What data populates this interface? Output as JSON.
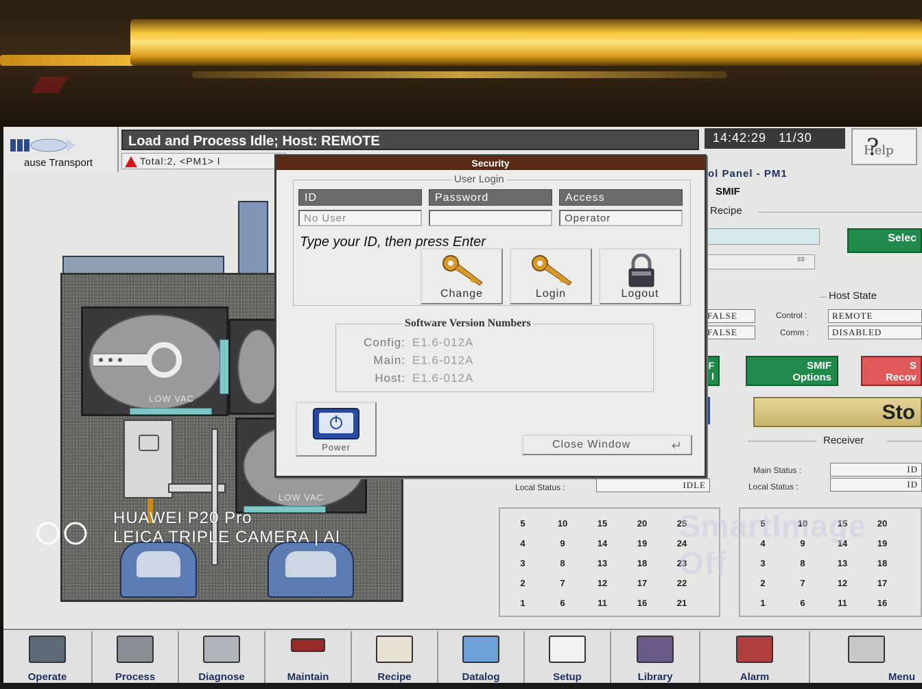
{
  "header": {
    "status": "Load and Process Idle; Host: REMOTE",
    "alarm": "Total:2, <PM1> l",
    "clock_time": "14:42:29",
    "clock_date": "11/30",
    "pause_label": "ause Transport",
    "help_label": "Help"
  },
  "security": {
    "title": "Security",
    "user_login_legend": "User Login",
    "columns": [
      "ID",
      "Password",
      "Access"
    ],
    "id_value": "No User",
    "password_value": "",
    "access_value": "Operator",
    "prompt": "Type your ID, then press Enter",
    "buttons": {
      "change": "Change",
      "login": "Login",
      "logout": "Logout"
    },
    "version_legend": "Software Version Numbers",
    "versions": [
      {
        "label": "Config:",
        "value": "E1.6-012A"
      },
      {
        "label": "Main:",
        "value": "E1.6-012A"
      },
      {
        "label": "Host:",
        "value": "E1.6-012A"
      }
    ],
    "power_label": "Power",
    "close_label": "Close Window"
  },
  "machine": {
    "chamber_label_1": "LOW VAC",
    "chamber_label_2": "LOW VAC"
  },
  "right_panel": {
    "title": "ol Panel - PM1",
    "smif": "SMIF",
    "recipe_label": "Recipe",
    "field_value": "ss",
    "select_label": "Selec",
    "host_state_legend": "Host State",
    "control_label": "Control :",
    "control_value": "REMOTE",
    "comm_label": "Comm :",
    "comm_value": "DISABLED",
    "flag_1": "FALSE",
    "flag_2": "FALSE",
    "btn_partial": "F\nl",
    "smif_options": "SMIF\nOptions",
    "smif_recovery": "S\nRecov",
    "stop_label": "Sto",
    "receiver_legend": "Receiver",
    "main_status_label": "Main Status :",
    "main_status_value": "ID",
    "local_status_label": "Local Status :",
    "local_status_value": "ID",
    "left_local_status_label": "Local Status :",
    "left_local_status_value": "IDLE"
  },
  "grid_left": [
    [
      "5",
      "10",
      "15",
      "20",
      "25"
    ],
    [
      "4",
      "9",
      "14",
      "19",
      "24"
    ],
    [
      "3",
      "8",
      "13",
      "18",
      "23"
    ],
    [
      "2",
      "7",
      "12",
      "17",
      "22"
    ],
    [
      "1",
      "6",
      "11",
      "16",
      "21"
    ]
  ],
  "grid_right": [
    [
      "5",
      "10",
      "15",
      "20"
    ],
    [
      "4",
      "9",
      "14",
      "19"
    ],
    [
      "3",
      "8",
      "13",
      "18"
    ],
    [
      "2",
      "7",
      "12",
      "17"
    ],
    [
      "1",
      "6",
      "11",
      "16"
    ]
  ],
  "toolbar": [
    "Operate",
    "Process",
    "Diagnose",
    "Maintain",
    "Recipe",
    "Datalog",
    "Setup",
    "Library",
    "Alarm",
    "Menu"
  ],
  "watermark": {
    "line1": "HUAWEI P20 Pro",
    "line2": "LEICA TRIPLE CAMERA | AI",
    "ghost": "SmartImage Off"
  },
  "colors": {
    "title_bar": "#5a2a14",
    "green_button": "#1f8a4a",
    "red_button": "#e05a5a",
    "header_bar": "#4a4a4a"
  }
}
